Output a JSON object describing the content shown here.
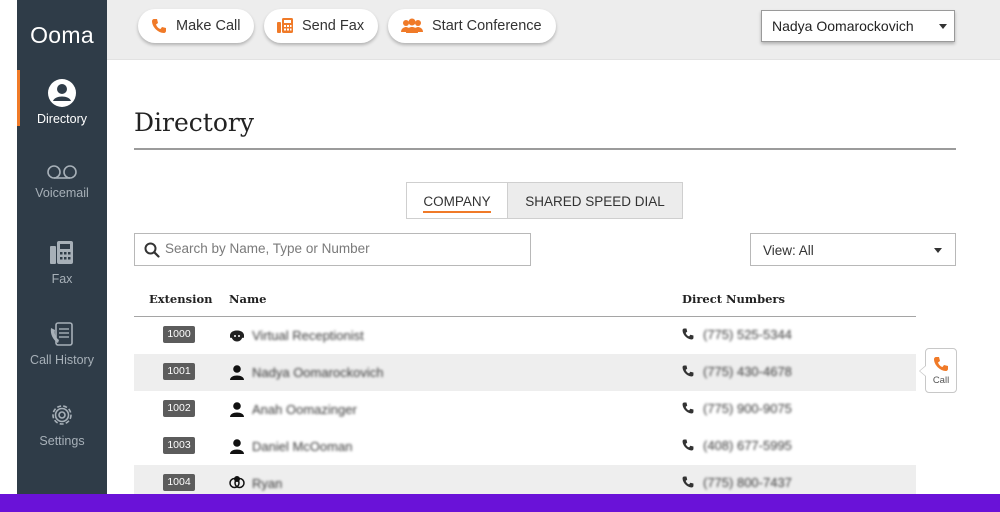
{
  "brand": {
    "logo_text": "Ooma",
    "accent_color": "#f07a28",
    "sidebar_color": "#2f3c48",
    "bottom_bar_color": "#6a12d8"
  },
  "sidebar": {
    "items": [
      {
        "label": "Directory",
        "icon": "person-circle-icon",
        "active": true
      },
      {
        "label": "Voicemail",
        "icon": "voicemail-icon",
        "active": false
      },
      {
        "label": "Fax",
        "icon": "fax-icon",
        "active": false
      },
      {
        "label": "Call History",
        "icon": "call-history-icon",
        "active": false
      },
      {
        "label": "Settings",
        "icon": "gear-icon",
        "active": false
      }
    ]
  },
  "toolbar": {
    "make_call": "Make Call",
    "send_fax": "Send Fax",
    "start_conference": "Start Conference",
    "user": "Nadya Oomarockovich"
  },
  "main": {
    "title": "Directory",
    "tabs": [
      {
        "label": "COMPANY",
        "active": true
      },
      {
        "label": "SHARED SPEED DIAL",
        "active": false
      }
    ],
    "search_placeholder": "Search by Name, Type or Number",
    "view_filter": "View: All"
  },
  "table": {
    "headers": {
      "extension": "Extension",
      "name": "Name",
      "direct_numbers": "Direct Numbers"
    },
    "rows": [
      {
        "extension": "1000",
        "name": "Virtual Receptionist",
        "number": "(775) 525-5344",
        "type": "receptionist-icon"
      },
      {
        "extension": "1001",
        "name": "Nadya Oomarockovich",
        "number": "(775) 430-4678",
        "type": "person-icon"
      },
      {
        "extension": "1002",
        "name": "Anah Oomazinger",
        "number": "(775) 900-9075",
        "type": "person-icon"
      },
      {
        "extension": "1003",
        "name": "Daniel McOoman",
        "number": "(408) 677-5995",
        "type": "person-icon"
      },
      {
        "extension": "1004",
        "name": "Ryan",
        "number": "(775) 800-7437",
        "type": "group-icon"
      }
    ]
  },
  "call_popover": {
    "label": "Call"
  }
}
